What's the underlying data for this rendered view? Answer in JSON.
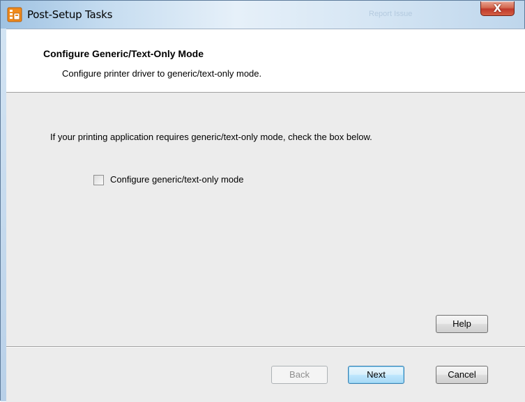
{
  "window": {
    "title": "Post-Setup Tasks",
    "title_ghost": "Report Issue",
    "close_glyph": "X",
    "icon": "setup-tasks-icon"
  },
  "header": {
    "title": "Configure Generic/Text-Only Mode",
    "subtitle": "Configure printer driver to generic/text-only mode."
  },
  "body": {
    "instruction": "If your printing application requires generic/text-only mode, check the box below.",
    "checkbox": {
      "label": "Configure generic/text-only mode",
      "checked": false
    }
  },
  "buttons": {
    "help": "Help",
    "back": "Back",
    "next": "Next",
    "cancel": "Cancel"
  },
  "colors": {
    "accent_default_button": "#3c7fb1",
    "close_button": "#c0392b",
    "app_icon": "#f08a1c"
  }
}
